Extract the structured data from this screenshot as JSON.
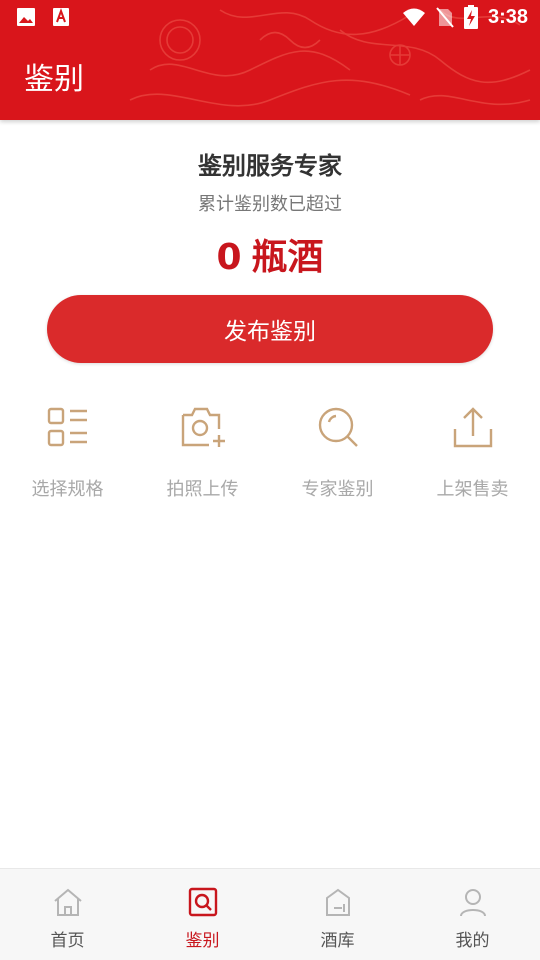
{
  "status_bar": {
    "time": "3:38",
    "left_icons": [
      "image-icon",
      "app-a-icon"
    ],
    "right_icons": [
      "wifi-icon",
      "no-sim-icon",
      "battery-charging-icon"
    ]
  },
  "header": {
    "title": "鉴别",
    "background_color": "#d9151b"
  },
  "hero": {
    "title": "鉴别服务专家",
    "subtitle": "累计鉴别数已超过",
    "count_value": "0",
    "count_unit": "瓶酒",
    "accent_color": "#c8161d"
  },
  "publish_button": {
    "label": "发布鉴别",
    "color": "#da2a2b"
  },
  "steps": [
    {
      "label": "选择规格",
      "icon": "list-grid-icon"
    },
    {
      "label": "拍照上传",
      "icon": "camera-plus-icon"
    },
    {
      "label": "专家鉴别",
      "icon": "magnifier-icon"
    },
    {
      "label": "上架售卖",
      "icon": "share-upload-icon"
    }
  ],
  "step_icon_color": "#c9a47a",
  "tabbar": {
    "active_index": 1,
    "items": [
      {
        "label": "首页",
        "icon": "home-icon"
      },
      {
        "label": "鉴别",
        "icon": "appraise-icon"
      },
      {
        "label": "酒库",
        "icon": "warehouse-icon"
      },
      {
        "label": "我的",
        "icon": "profile-icon"
      }
    ]
  }
}
